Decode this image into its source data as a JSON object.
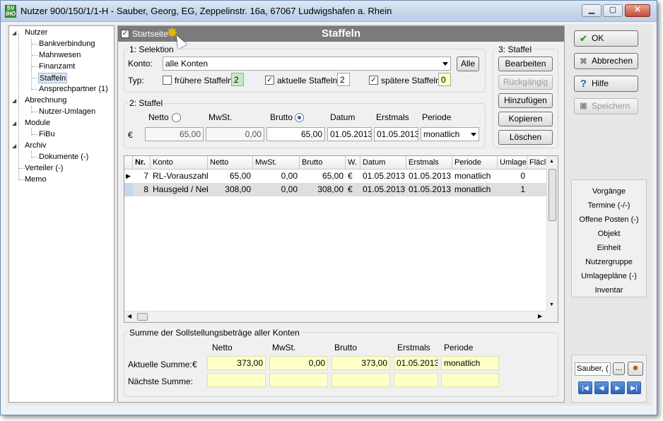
{
  "window": {
    "title": "Nutzer 900/150/1/1-H - Sauber, Georg, EG, Zeppelinstr. 16a, 67067 Ludwigshafen a. Rhein",
    "app_icon_text": "SV iHO"
  },
  "tree": {
    "items": [
      {
        "label": "Nutzer"
      },
      {
        "label": "Bankverbindung"
      },
      {
        "label": "Mahnwesen"
      },
      {
        "label": "Finanzamt"
      },
      {
        "label": "Staffeln"
      },
      {
        "label": "Ansprechpartner (1)"
      },
      {
        "label": "Abrechnung"
      },
      {
        "label": "Nutzer-Umlagen"
      },
      {
        "label": "Module"
      },
      {
        "label": "FiBu"
      },
      {
        "label": "Archiv"
      },
      {
        "label": "Dokumente (-)"
      },
      {
        "label": "Verteiler (-)"
      },
      {
        "label": "Memo"
      }
    ]
  },
  "header": {
    "start_label": "Startseite",
    "title": "Staffeln",
    "start_checked": "✓"
  },
  "selektion": {
    "group_label": "1: Selektion",
    "konto_label": "Konto:",
    "konto_value": "alle Konten",
    "alle_button": "Alle",
    "typ_label": "Typ:",
    "fruehere_label": "frühere Staffeln:",
    "fruehere_count": "2",
    "aktuelle_label": "aktuelle Staffeln:",
    "aktuelle_count": "2",
    "spaetere_label": "spätere Staffeln:",
    "spaetere_count": "0",
    "check": "✓"
  },
  "staffel": {
    "group_label": "2: Staffel",
    "netto_label": "Netto",
    "mwst_label": "MwSt.",
    "brutto_label": "Brutto",
    "datum_label": "Datum",
    "erstmals_label": "Erstmals",
    "periode_label": "Periode",
    "currency": "€",
    "netto": "65,00",
    "mwst": "0,00",
    "brutto": "65,00",
    "datum": "01.05.2013",
    "erstmals": "01.05.2013",
    "periode": "monatlich"
  },
  "staffel3": {
    "group_label": "3: Staffel",
    "bearbeiten": "Bearbeiten",
    "rueckgaengig": "Rückgängig",
    "hinzufuegen": "Hinzufügen",
    "kopieren": "Kopieren",
    "loeschen": "Löschen"
  },
  "grid": {
    "columns": [
      "Nr.",
      "Konto",
      "Netto",
      "MwSt.",
      "Brutto",
      "W.",
      "Datum",
      "Erstmals",
      "Periode",
      "Umlage",
      "Fläcl"
    ],
    "rows": [
      {
        "nr": "7",
        "konto": "RL-Vorauszahlu",
        "netto": "65,00",
        "mwst": "0,00",
        "brutto": "65,00",
        "w": "€",
        "datum": "01.05.2013",
        "erstmals": "01.05.2013",
        "periode": "monatlich",
        "umlage": "0"
      },
      {
        "nr": "8",
        "konto": "Hausgeld / Neb",
        "netto": "308,00",
        "mwst": "0,00",
        "brutto": "308,00",
        "w": "€",
        "datum": "01.05.2013",
        "erstmals": "01.05.2013",
        "periode": "monatlich",
        "umlage": "1"
      }
    ]
  },
  "summe": {
    "group_label": "Summe der Sollstellungsbeträge aller Konten",
    "netto_label": "Netto",
    "mwst_label": "MwSt.",
    "brutto_label": "Brutto",
    "erstmals_label": "Erstmals",
    "periode_label": "Periode",
    "aktuelle_label": "Aktuelle Summe:",
    "currency": "€",
    "naechste_label": "Nächste Summe:",
    "netto": "373,00",
    "mwst": "0,00",
    "brutto": "373,00",
    "erstmals": "01.05.2013",
    "periode": "monatlich"
  },
  "actions": {
    "ok": "OK",
    "abbrechen": "Abbrechen",
    "hilfe": "Hilfe",
    "speichern": "Speichern"
  },
  "nav": {
    "items": [
      "Vorgänge",
      "Termine (-/-)",
      "Offene Posten (-)",
      "Objekt",
      "Einheit",
      "Nutzergruppe",
      "Umlagepläne (-)",
      "Inventar"
    ]
  },
  "record": {
    "name": "Sauber, (",
    "more": "..."
  },
  "colors": {
    "header_bg": "#7b7b7b",
    "yellow": "#ffffc8",
    "green": "#c8e8c8",
    "nav_blue": "#2a63b8"
  }
}
